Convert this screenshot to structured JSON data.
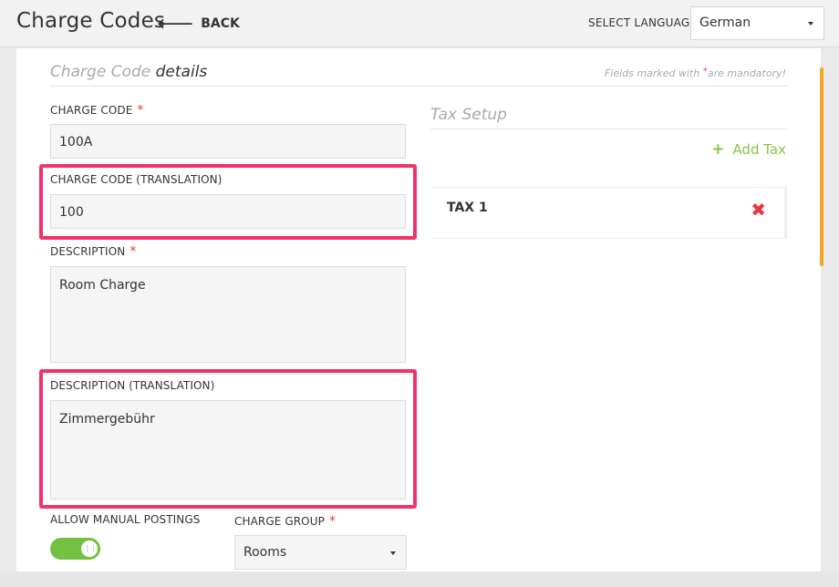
{
  "header": {
    "title": "Charge Codes",
    "back_label": "BACK",
    "back_arrow": "🡐",
    "language_label": "SELECT LANGUAGE",
    "language_value": "German"
  },
  "details": {
    "title_light": "Charge Code",
    "title_dark": "details",
    "mandatory_note_prefix": "Fields marked with",
    "mandatory_note_star": "*",
    "mandatory_note_suffix": "are mandatory!"
  },
  "form": {
    "charge_code_label": "CHARGE CODE",
    "charge_code_value": "100A",
    "charge_code_translation_label": "CHARGE CODE (TRANSLATION)",
    "charge_code_translation_value": "100",
    "description_label": "DESCRIPTION",
    "description_value": "Room Charge",
    "description_translation_label": "DESCRIPTION (TRANSLATION)",
    "description_translation_value": "Zimmergebühr",
    "allow_manual_postings_label": "ALLOW MANUAL POSTINGS",
    "allow_manual_postings_on": true,
    "charge_group_label": "CHARGE GROUP",
    "charge_group_value": "Rooms",
    "required_star": "*"
  },
  "tax": {
    "title": "Tax Setup",
    "add_label": "Add Tax",
    "add_symbol": "+",
    "items": [
      {
        "name": "TAX 1",
        "remove_symbol": "✖"
      }
    ]
  },
  "colors": {
    "accent_green": "#8bc34a",
    "toggle_green": "#74c043",
    "required_red": "#e8383d",
    "highlight_pink": "#f0346b",
    "scroll_orange": "#f6a623"
  }
}
